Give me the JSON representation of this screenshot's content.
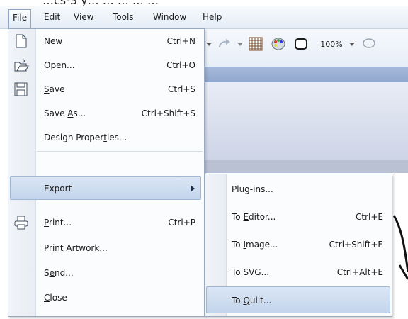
{
  "top_strip_text": "…cs-3 y… … … … …",
  "menubar": {
    "file": "File",
    "edit": "Edit",
    "view": "View",
    "tools": "Tools",
    "window": "Window",
    "help": "Help"
  },
  "toolbar": {
    "zoom": "100%",
    "icons": [
      "dropdown-arrow-icon",
      "redo-icon",
      "dropdown-arrow-icon",
      "grid-icon",
      "palette-icon",
      "hoop-icon",
      "dropdown-arrow-icon",
      "lasso-icon"
    ]
  },
  "file_menu": {
    "new": {
      "pre": "Ne",
      "u": "w",
      "post": "",
      "shortcut": "Ctrl+N"
    },
    "open": {
      "pre": "",
      "u": "O",
      "post": "pen...",
      "shortcut": "Ctrl+O"
    },
    "save": {
      "pre": "",
      "u": "S",
      "post": "ave",
      "shortcut": "Ctrl+S"
    },
    "save_as": {
      "pre": "Save ",
      "u": "A",
      "post": "s...",
      "shortcut": "Ctrl+Shift+S"
    },
    "design_properties": {
      "pre": "Design Proper",
      "u": "t",
      "post": "ies..."
    },
    "export": "Export",
    "print": {
      "pre": "",
      "u": "P",
      "post": "rint...",
      "shortcut": "Ctrl+P"
    },
    "print_artwork": "Print Artwork...",
    "send": {
      "pre": "S",
      "u": "e",
      "post": "nd..."
    },
    "close": {
      "pre": "",
      "u": "C",
      "post": "lose"
    }
  },
  "export_menu": {
    "plugins": "Plug-ins...",
    "to_editor": {
      "pre": "To ",
      "u": "E",
      "post": "ditor...",
      "shortcut": "Ctrl+E"
    },
    "to_image": {
      "pre": "To ",
      "u": "I",
      "post": "mage...",
      "shortcut": "Ctrl+Shift+E"
    },
    "to_svg": {
      "pre": "To SVG...",
      "shortcut": "Ctrl+Alt+E"
    },
    "to_quilt": {
      "pre": "To ",
      "u": "Q",
      "post": "uilt..."
    }
  }
}
